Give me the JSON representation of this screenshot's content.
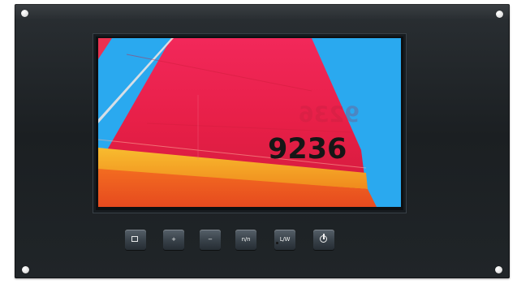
{
  "device": {
    "name": "display-monitor",
    "colors": {
      "frame": "#1f2326",
      "screen_sky": "#2aa9ef",
      "sail_red": "#e61f45",
      "sail_orange": "#f26a1b",
      "band_yellow": "#f7b52b",
      "screw": "#f2f2f2"
    }
  },
  "screen": {
    "sail_number": "9236"
  },
  "controls": {
    "buttons": [
      {
        "icon": "menu-icon",
        "label": ""
      },
      {
        "icon": "plus-icon",
        "label": "+"
      },
      {
        "icon": "minus-icon",
        "label": "−"
      },
      {
        "icon": "na-icon",
        "label": "n/n"
      },
      {
        "icon": "ratio-icon",
        "label": "L/W"
      },
      {
        "icon": "power-icon",
        "label": ""
      }
    ]
  }
}
